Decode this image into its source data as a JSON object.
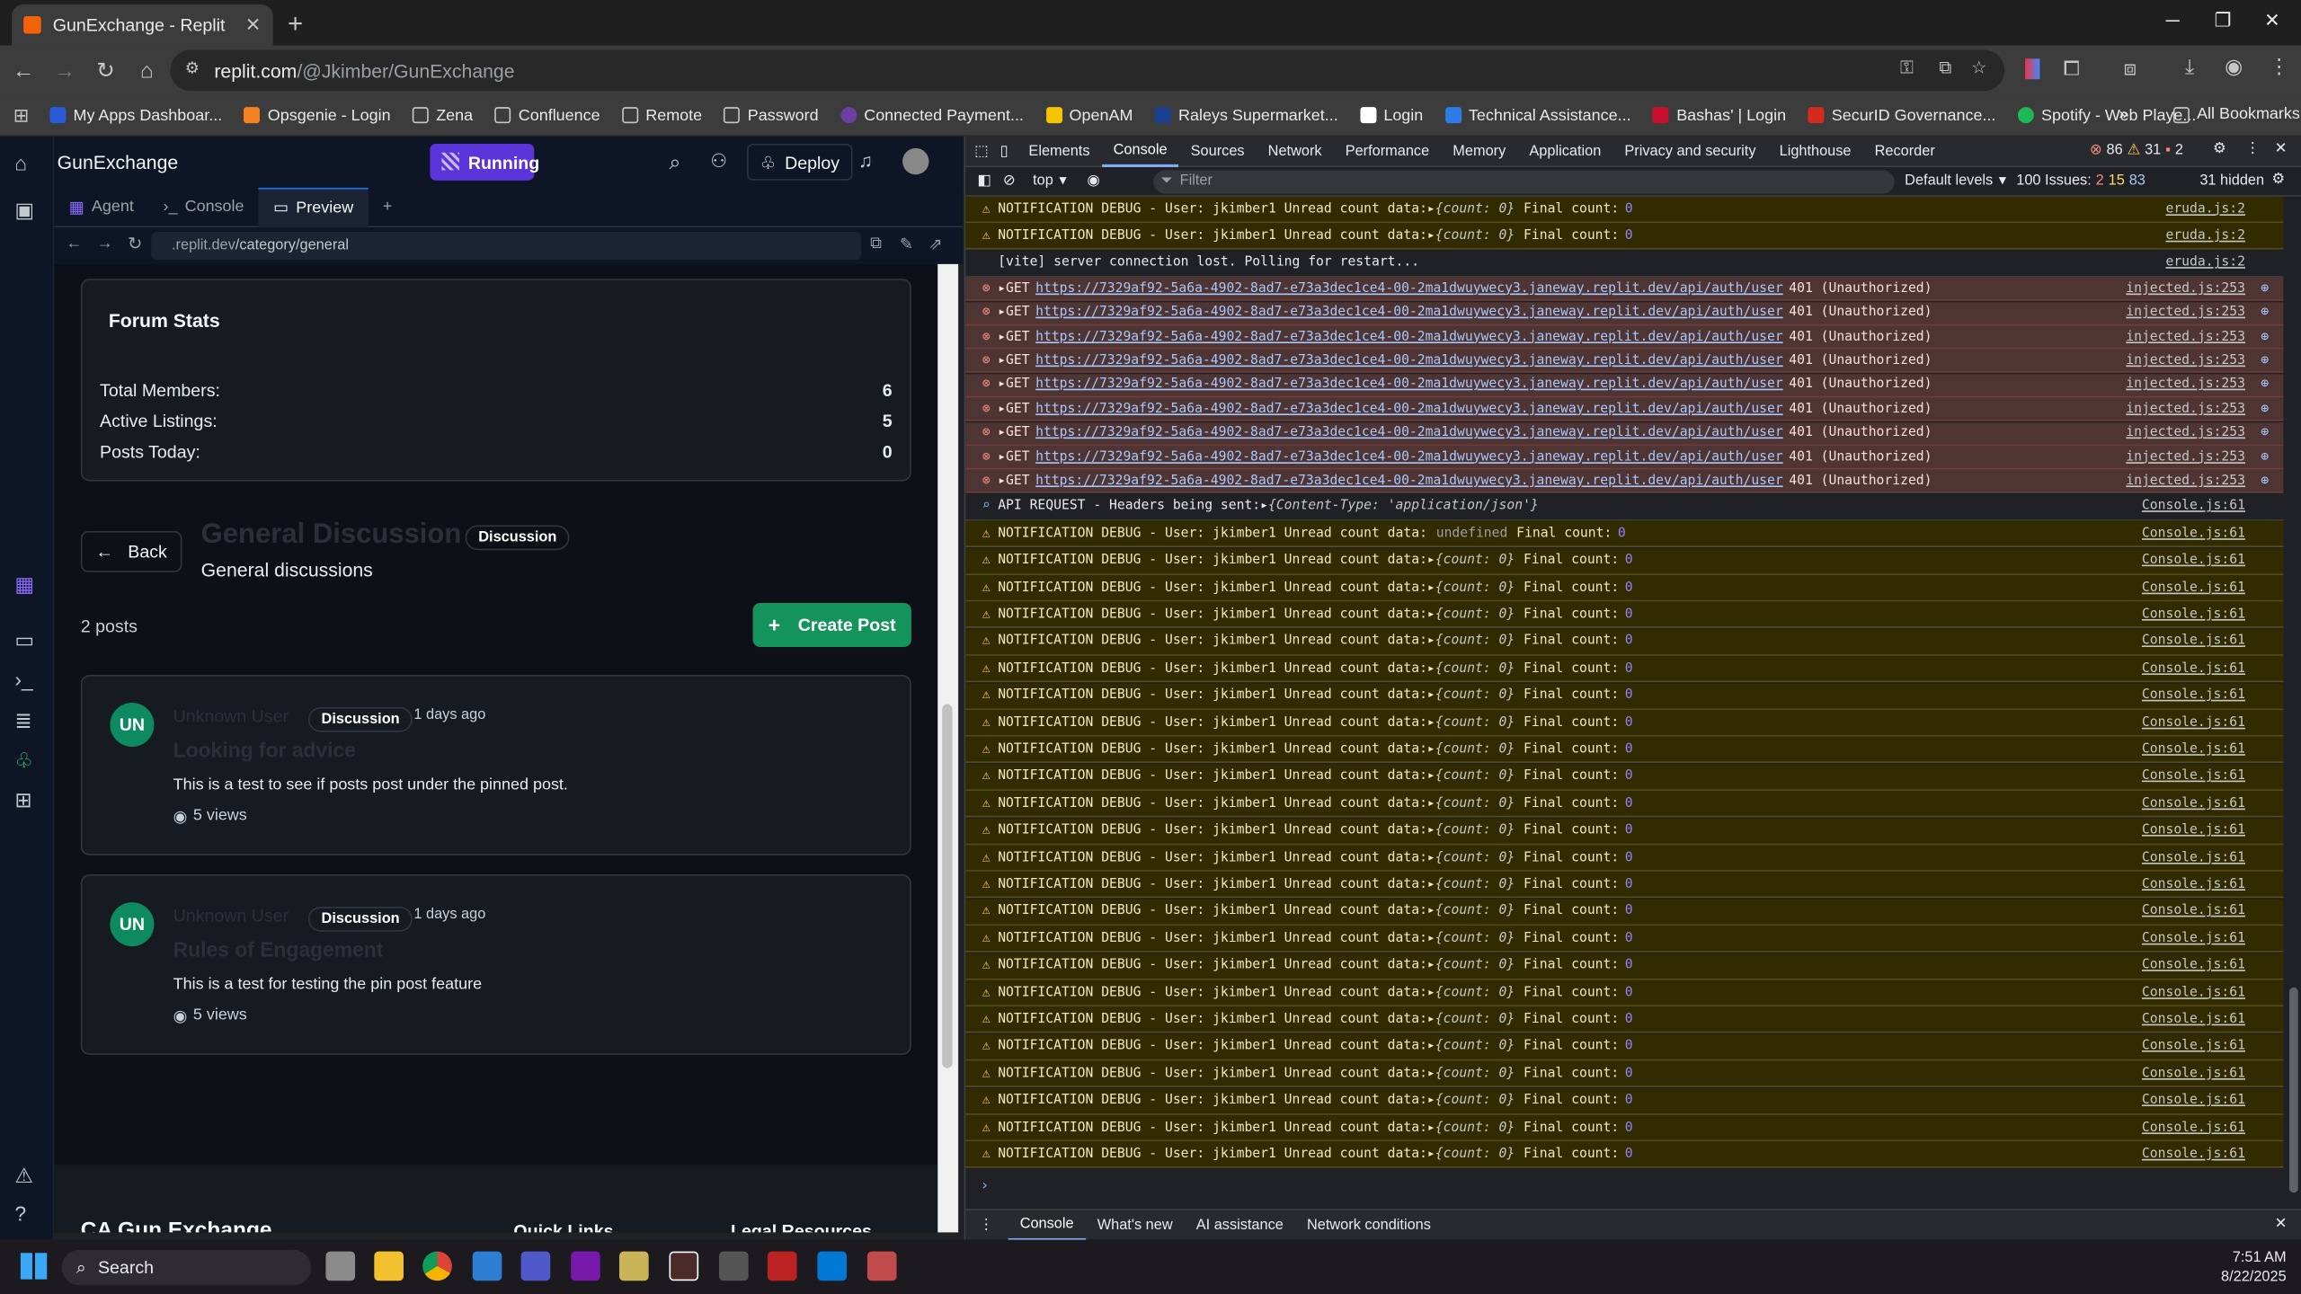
{
  "browser": {
    "tab_title": "GunExchange - Replit",
    "url_host": "replit.com",
    "url_path": "/@Jkimber/GunExchange",
    "bookmarks": [
      "My Apps Dashboar...",
      "Opsgenie - Login",
      "Zena",
      "Confluence",
      "Remote",
      "Password",
      "Connected Payment...",
      "OpenAM",
      "Raleys Supermarket...",
      "Login",
      "Technical Assistance...",
      "Bashas' | Login",
      "SecurID Governance...",
      "Spotify - Web Playe..."
    ],
    "all_bookmarks": "All Bookmarks"
  },
  "replit": {
    "project_name": "GunExchange",
    "run_label": "Running",
    "deploy_label": "Deploy",
    "tabs": [
      "Agent",
      "Console",
      "Preview"
    ],
    "preview_url_dim": ".replit.dev",
    "preview_url_path": "/category/general"
  },
  "forum": {
    "stats_title": "Forum Stats",
    "stats": [
      {
        "label": "Total Members:",
        "value": "6"
      },
      {
        "label": "Active Listings:",
        "value": "5"
      },
      {
        "label": "Posts Today:",
        "value": "0"
      }
    ],
    "back_label": "Back",
    "category_title": "General Discussion",
    "category_badge": "Discussion",
    "category_desc": "General discussions",
    "post_count": "2 posts",
    "create_label": "Create Post",
    "posts": [
      {
        "initials": "UN",
        "author": "Unknown User",
        "badge": "Discussion",
        "time": "1 days ago",
        "title": "Looking for advice",
        "body": "This is a test to see if posts post under the pinned post.",
        "views": "5 views"
      },
      {
        "initials": "UN",
        "author": "Unknown User",
        "badge": "Discussion",
        "time": "1 days ago",
        "title": "Rules of Engagement",
        "body": "This is a test for testing the pin post feature",
        "views": "5 views"
      }
    ],
    "footer": {
      "brand": "CA Gun Exchange",
      "quick_links": "Quick Links",
      "legal": "Legal Resources"
    }
  },
  "devtools": {
    "tabs": [
      "Elements",
      "Console",
      "Sources",
      "Network",
      "Performance",
      "Memory",
      "Application",
      "Privacy and security",
      "Lighthouse",
      "Recorder"
    ],
    "err_count": "86",
    "warn_count": "31",
    "info_count": "2",
    "context": "top",
    "filter_placeholder": "Filter",
    "levels": "Default levels",
    "issues": "100 Issues:",
    "issue_e": "2",
    "issue_w": "15",
    "issue_i": "83",
    "hidden": "31 hidden",
    "drawer_tabs": [
      "Console",
      "What's new",
      "AI assistance",
      "Network conditions"
    ],
    "notif_text": "NOTIFICATION DEBUG - User: jkimber1 Unread count data:",
    "final_text": "Final count:",
    "count_obj": "{count: 0}",
    "zero": "0",
    "eruda_src": "eruda.js:2",
    "vite_msg": "[vite] server connection lost. Polling for restart...",
    "get_label": "GET",
    "get_url": "https://7329af92-5a6a-4902-8ad7-e73a3dec1ce4-00-2ma1dwuywecy3.janeway.replit.dev/api/auth/user",
    "get_status": "401 (Unauthorized)",
    "injected_src": "injected.js:253",
    "api_msg": "API REQUEST - Headers being sent:",
    "api_obj": "{Content-Type: 'application/json'}",
    "console_src": "Console.js:61",
    "undef_text": "undefined"
  },
  "taskbar": {
    "search": "Search",
    "time": "7:51 AM",
    "date": "8/22/2025"
  }
}
